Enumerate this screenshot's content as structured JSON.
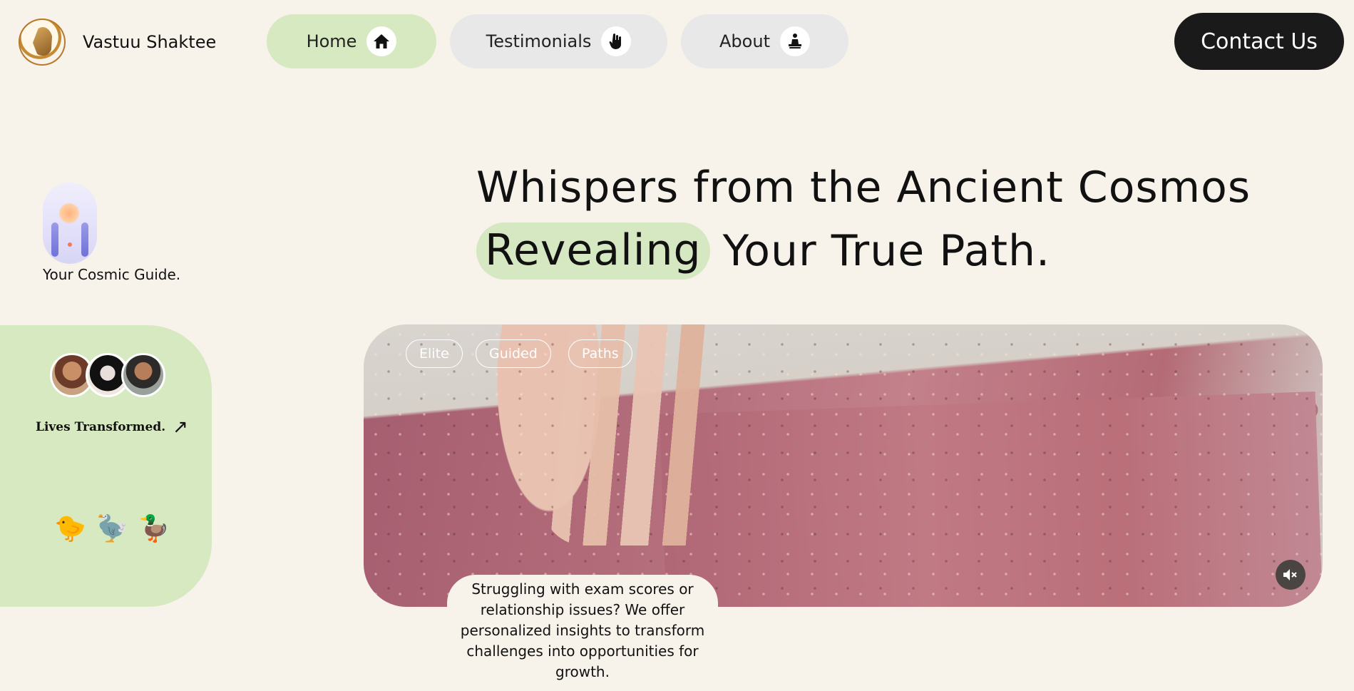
{
  "header": {
    "brand_name": "Vastuu Shaktee",
    "logo_icon": "golden-face-logo",
    "nav": [
      {
        "label": "Home",
        "icon": "home-icon",
        "active": true
      },
      {
        "label": "Testimonials",
        "icon": "hand-icon",
        "active": false
      },
      {
        "label": "About",
        "icon": "meditation-icon",
        "active": false
      }
    ],
    "contact_label": "Contact Us"
  },
  "hero": {
    "line1": "Whispers from the Ancient Cosmos",
    "highlight": "Revealing",
    "line2_rest": "Your True Path."
  },
  "guide": {
    "caption": "Your Cosmic Guide."
  },
  "side_card": {
    "lives_label": "Lives Transformed.",
    "arrow": "↗",
    "emojis": [
      "🐤",
      "🦤",
      "🦆"
    ]
  },
  "video": {
    "tags": [
      "Elite",
      "Guided",
      "Paths"
    ],
    "mute_icon": "🔇"
  },
  "blurb": "Struggling with exam scores or relationship issues? We offer personalized insights to transform challenges into opportunities for growth.",
  "colors": {
    "background": "#f7f2ea",
    "accent_green": "#d7e9c1",
    "pill_gray": "#e8e8e8",
    "dark_button": "#1a1a1a"
  }
}
